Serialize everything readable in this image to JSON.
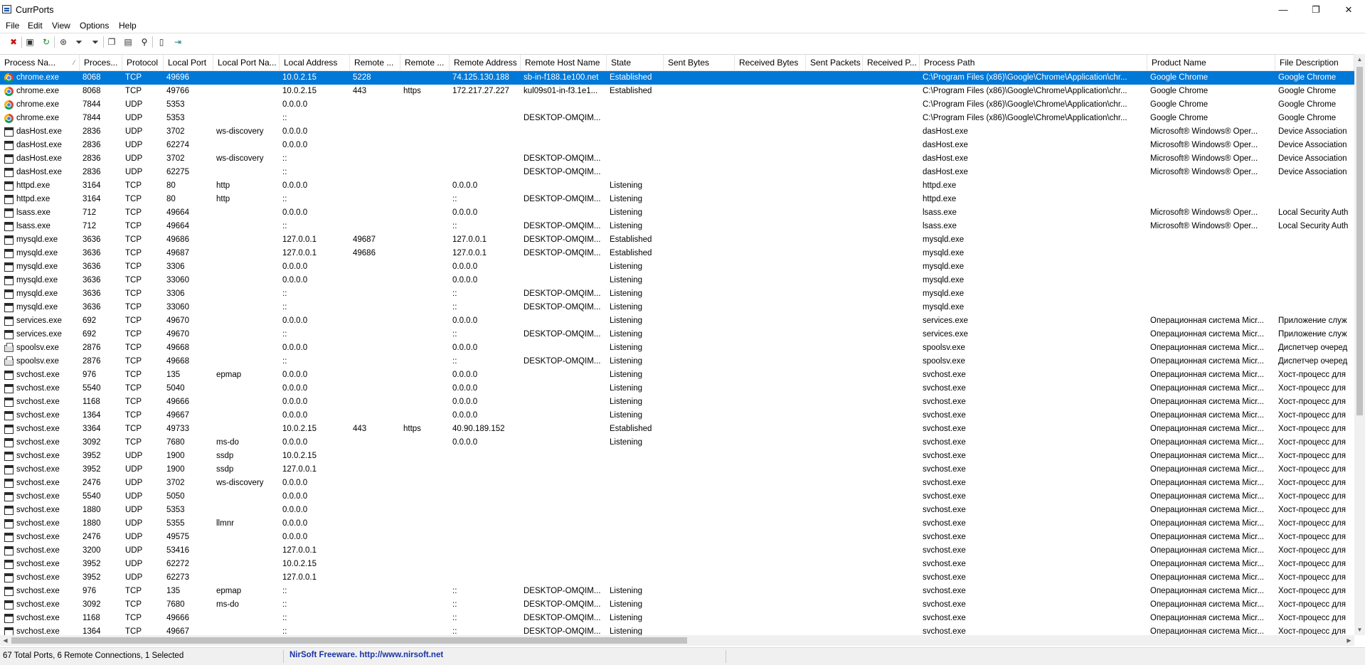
{
  "window": {
    "title": "CurrPorts",
    "minimize": "—",
    "maximize": "❐",
    "close": "✕"
  },
  "menu": [
    "File",
    "Edit",
    "View",
    "Options",
    "Help"
  ],
  "toolbar": [
    {
      "name": "delete-icon",
      "glyph": "✖",
      "color": "#cc1111"
    },
    {
      "name": "save-icon",
      "glyph": "▣",
      "color": "#333333"
    },
    {
      "name": "refresh-icon",
      "glyph": "↻",
      "color": "#188a2a"
    },
    {
      "name": "options-icon",
      "glyph": "⊛",
      "color": "#333333"
    },
    {
      "name": "filter-icon",
      "glyph": "⏷",
      "color": "#333333"
    },
    {
      "name": "advanced-filter-icon",
      "glyph": "⏷",
      "color": "#333333"
    },
    {
      "name": "copy-icon",
      "glyph": "❐",
      "color": "#333333"
    },
    {
      "name": "properties-icon",
      "glyph": "▤",
      "color": "#333333"
    },
    {
      "name": "find-icon",
      "glyph": "⚲",
      "color": "#111111"
    },
    {
      "name": "report-icon",
      "glyph": "▯",
      "color": "#333333"
    },
    {
      "name": "exit-icon",
      "glyph": "⇥",
      "color": "#1a7a80"
    }
  ],
  "columns": [
    "Process Na...",
    "Proces...",
    "Protocol",
    "Local Port",
    "Local Port Na...",
    "Local Address",
    "Remote ...",
    "Remote ...",
    "Remote Address",
    "Remote Host Name",
    "State",
    "Sent Bytes",
    "Received Bytes",
    "Sent Packets",
    "Received P...",
    "Process Path",
    "Product Name",
    "File Description"
  ],
  "rows": [
    {
      "icon": "chrome",
      "selected": true,
      "cells": [
        "chrome.exe",
        "8068",
        "TCP",
        "49696",
        "",
        "10.0.2.15",
        "5228",
        "",
        "74.125.130.188",
        "sb-in-f188.1e100.net",
        "Established",
        "",
        "",
        "",
        "",
        "C:\\Program Files (x86)\\Google\\Chrome\\Application\\chr...",
        "Google Chrome",
        "Google Chrome"
      ]
    },
    {
      "icon": "chrome",
      "cells": [
        "chrome.exe",
        "8068",
        "TCP",
        "49766",
        "",
        "10.0.2.15",
        "443",
        "https",
        "172.217.27.227",
        "kul09s01-in-f3.1e1...",
        "Established",
        "",
        "",
        "",
        "",
        "C:\\Program Files (x86)\\Google\\Chrome\\Application\\chr...",
        "Google Chrome",
        "Google Chrome"
      ]
    },
    {
      "icon": "chrome",
      "cells": [
        "chrome.exe",
        "7844",
        "UDP",
        "5353",
        "",
        "0.0.0.0",
        "",
        "",
        "",
        "",
        "",
        "",
        "",
        "",
        "",
        "C:\\Program Files (x86)\\Google\\Chrome\\Application\\chr...",
        "Google Chrome",
        "Google Chrome"
      ]
    },
    {
      "icon": "chrome",
      "cells": [
        "chrome.exe",
        "7844",
        "UDP",
        "5353",
        "",
        "::",
        "",
        "",
        "",
        "DESKTOP-OMQIM...",
        "",
        "",
        "",
        "",
        "",
        "C:\\Program Files (x86)\\Google\\Chrome\\Application\\chr...",
        "Google Chrome",
        "Google Chrome"
      ]
    },
    {
      "icon": "window",
      "cells": [
        "dasHost.exe",
        "2836",
        "UDP",
        "3702",
        "ws-discovery",
        "0.0.0.0",
        "",
        "",
        "",
        "",
        "",
        "",
        "",
        "",
        "",
        "dasHost.exe",
        "Microsoft® Windows® Oper...",
        "Device Association"
      ]
    },
    {
      "icon": "window",
      "cells": [
        "dasHost.exe",
        "2836",
        "UDP",
        "62274",
        "",
        "0.0.0.0",
        "",
        "",
        "",
        "",
        "",
        "",
        "",
        "",
        "",
        "dasHost.exe",
        "Microsoft® Windows® Oper...",
        "Device Association"
      ]
    },
    {
      "icon": "window",
      "cells": [
        "dasHost.exe",
        "2836",
        "UDP",
        "3702",
        "ws-discovery",
        "::",
        "",
        "",
        "",
        "DESKTOP-OMQIM...",
        "",
        "",
        "",
        "",
        "",
        "dasHost.exe",
        "Microsoft® Windows® Oper...",
        "Device Association"
      ]
    },
    {
      "icon": "window",
      "cells": [
        "dasHost.exe",
        "2836",
        "UDP",
        "62275",
        "",
        "::",
        "",
        "",
        "",
        "DESKTOP-OMQIM...",
        "",
        "",
        "",
        "",
        "",
        "dasHost.exe",
        "Microsoft® Windows® Oper...",
        "Device Association"
      ]
    },
    {
      "icon": "window",
      "cells": [
        "httpd.exe",
        "3164",
        "TCP",
        "80",
        "http",
        "0.0.0.0",
        "",
        "",
        "0.0.0.0",
        "",
        "Listening",
        "",
        "",
        "",
        "",
        "httpd.exe",
        "",
        ""
      ]
    },
    {
      "icon": "window",
      "cells": [
        "httpd.exe",
        "3164",
        "TCP",
        "80",
        "http",
        "::",
        "",
        "",
        "::",
        "DESKTOP-OMQIM...",
        "Listening",
        "",
        "",
        "",
        "",
        "httpd.exe",
        "",
        ""
      ]
    },
    {
      "icon": "window",
      "cells": [
        "lsass.exe",
        "712",
        "TCP",
        "49664",
        "",
        "0.0.0.0",
        "",
        "",
        "0.0.0.0",
        "",
        "Listening",
        "",
        "",
        "",
        "",
        "lsass.exe",
        "Microsoft® Windows® Oper...",
        "Local Security Auth"
      ]
    },
    {
      "icon": "window",
      "cells": [
        "lsass.exe",
        "712",
        "TCP",
        "49664",
        "",
        "::",
        "",
        "",
        "::",
        "DESKTOP-OMQIM...",
        "Listening",
        "",
        "",
        "",
        "",
        "lsass.exe",
        "Microsoft® Windows® Oper...",
        "Local Security Auth"
      ]
    },
    {
      "icon": "window",
      "cells": [
        "mysqld.exe",
        "3636",
        "TCP",
        "49686",
        "",
        "127.0.0.1",
        "49687",
        "",
        "127.0.0.1",
        "DESKTOP-OMQIM...",
        "Established",
        "",
        "",
        "",
        "",
        "mysqld.exe",
        "",
        ""
      ]
    },
    {
      "icon": "window",
      "cells": [
        "mysqld.exe",
        "3636",
        "TCP",
        "49687",
        "",
        "127.0.0.1",
        "49686",
        "",
        "127.0.0.1",
        "DESKTOP-OMQIM...",
        "Established",
        "",
        "",
        "",
        "",
        "mysqld.exe",
        "",
        ""
      ]
    },
    {
      "icon": "window",
      "cells": [
        "mysqld.exe",
        "3636",
        "TCP",
        "3306",
        "",
        "0.0.0.0",
        "",
        "",
        "0.0.0.0",
        "",
        "Listening",
        "",
        "",
        "",
        "",
        "mysqld.exe",
        "",
        ""
      ]
    },
    {
      "icon": "window",
      "cells": [
        "mysqld.exe",
        "3636",
        "TCP",
        "33060",
        "",
        "0.0.0.0",
        "",
        "",
        "0.0.0.0",
        "",
        "Listening",
        "",
        "",
        "",
        "",
        "mysqld.exe",
        "",
        ""
      ]
    },
    {
      "icon": "window",
      "cells": [
        "mysqld.exe",
        "3636",
        "TCP",
        "3306",
        "",
        "::",
        "",
        "",
        "::",
        "DESKTOP-OMQIM...",
        "Listening",
        "",
        "",
        "",
        "",
        "mysqld.exe",
        "",
        ""
      ]
    },
    {
      "icon": "window",
      "cells": [
        "mysqld.exe",
        "3636",
        "TCP",
        "33060",
        "",
        "::",
        "",
        "",
        "::",
        "DESKTOP-OMQIM...",
        "Listening",
        "",
        "",
        "",
        "",
        "mysqld.exe",
        "",
        ""
      ]
    },
    {
      "icon": "window",
      "cells": [
        "services.exe",
        "692",
        "TCP",
        "49670",
        "",
        "0.0.0.0",
        "",
        "",
        "0.0.0.0",
        "",
        "Listening",
        "",
        "",
        "",
        "",
        "services.exe",
        "Операционная система Micr...",
        "Приложение служ"
      ]
    },
    {
      "icon": "window",
      "cells": [
        "services.exe",
        "692",
        "TCP",
        "49670",
        "",
        "::",
        "",
        "",
        "::",
        "DESKTOP-OMQIM...",
        "Listening",
        "",
        "",
        "",
        "",
        "services.exe",
        "Операционная система Micr...",
        "Приложение служ"
      ]
    },
    {
      "icon": "printer",
      "cells": [
        "spoolsv.exe",
        "2876",
        "TCP",
        "49668",
        "",
        "0.0.0.0",
        "",
        "",
        "0.0.0.0",
        "",
        "Listening",
        "",
        "",
        "",
        "",
        "spoolsv.exe",
        "Операционная система Micr...",
        "Диспетчер очеред"
      ]
    },
    {
      "icon": "printer",
      "cells": [
        "spoolsv.exe",
        "2876",
        "TCP",
        "49668",
        "",
        "::",
        "",
        "",
        "::",
        "DESKTOP-OMQIM...",
        "Listening",
        "",
        "",
        "",
        "",
        "spoolsv.exe",
        "Операционная система Micr...",
        "Диспетчер очеред"
      ]
    },
    {
      "icon": "window",
      "cells": [
        "svchost.exe",
        "976",
        "TCP",
        "135",
        "epmap",
        "0.0.0.0",
        "",
        "",
        "0.0.0.0",
        "",
        "Listening",
        "",
        "",
        "",
        "",
        "svchost.exe",
        "Операционная система Micr...",
        "Хост-процесс для"
      ]
    },
    {
      "icon": "window",
      "cells": [
        "svchost.exe",
        "5540",
        "TCP",
        "5040",
        "",
        "0.0.0.0",
        "",
        "",
        "0.0.0.0",
        "",
        "Listening",
        "",
        "",
        "",
        "",
        "svchost.exe",
        "Операционная система Micr...",
        "Хост-процесс для"
      ]
    },
    {
      "icon": "window",
      "cells": [
        "svchost.exe",
        "1168",
        "TCP",
        "49666",
        "",
        "0.0.0.0",
        "",
        "",
        "0.0.0.0",
        "",
        "Listening",
        "",
        "",
        "",
        "",
        "svchost.exe",
        "Операционная система Micr...",
        "Хост-процесс для"
      ]
    },
    {
      "icon": "window",
      "cells": [
        "svchost.exe",
        "1364",
        "TCP",
        "49667",
        "",
        "0.0.0.0",
        "",
        "",
        "0.0.0.0",
        "",
        "Listening",
        "",
        "",
        "",
        "",
        "svchost.exe",
        "Операционная система Micr...",
        "Хост-процесс для"
      ]
    },
    {
      "icon": "window",
      "cells": [
        "svchost.exe",
        "3364",
        "TCP",
        "49733",
        "",
        "10.0.2.15",
        "443",
        "https",
        "40.90.189.152",
        "",
        "Established",
        "",
        "",
        "",
        "",
        "svchost.exe",
        "Операционная система Micr...",
        "Хост-процесс для"
      ]
    },
    {
      "icon": "window",
      "cells": [
        "svchost.exe",
        "3092",
        "TCP",
        "7680",
        "ms-do",
        "0.0.0.0",
        "",
        "",
        "0.0.0.0",
        "",
        "Listening",
        "",
        "",
        "",
        "",
        "svchost.exe",
        "Операционная система Micr...",
        "Хост-процесс для"
      ]
    },
    {
      "icon": "window",
      "cells": [
        "svchost.exe",
        "3952",
        "UDP",
        "1900",
        "ssdp",
        "10.0.2.15",
        "",
        "",
        "",
        "",
        "",
        "",
        "",
        "",
        "",
        "svchost.exe",
        "Операционная система Micr...",
        "Хост-процесс для"
      ]
    },
    {
      "icon": "window",
      "cells": [
        "svchost.exe",
        "3952",
        "UDP",
        "1900",
        "ssdp",
        "127.0.0.1",
        "",
        "",
        "",
        "",
        "",
        "",
        "",
        "",
        "",
        "svchost.exe",
        "Операционная система Micr...",
        "Хост-процесс для"
      ]
    },
    {
      "icon": "window",
      "cells": [
        "svchost.exe",
        "2476",
        "UDP",
        "3702",
        "ws-discovery",
        "0.0.0.0",
        "",
        "",
        "",
        "",
        "",
        "",
        "",
        "",
        "",
        "svchost.exe",
        "Операционная система Micr...",
        "Хост-процесс для"
      ]
    },
    {
      "icon": "window",
      "cells": [
        "svchost.exe",
        "5540",
        "UDP",
        "5050",
        "",
        "0.0.0.0",
        "",
        "",
        "",
        "",
        "",
        "",
        "",
        "",
        "",
        "svchost.exe",
        "Операционная система Micr...",
        "Хост-процесс для"
      ]
    },
    {
      "icon": "window",
      "cells": [
        "svchost.exe",
        "1880",
        "UDP",
        "5353",
        "",
        "0.0.0.0",
        "",
        "",
        "",
        "",
        "",
        "",
        "",
        "",
        "",
        "svchost.exe",
        "Операционная система Micr...",
        "Хост-процесс для"
      ]
    },
    {
      "icon": "window",
      "cells": [
        "svchost.exe",
        "1880",
        "UDP",
        "5355",
        "llmnr",
        "0.0.0.0",
        "",
        "",
        "",
        "",
        "",
        "",
        "",
        "",
        "",
        "svchost.exe",
        "Операционная система Micr...",
        "Хост-процесс для"
      ]
    },
    {
      "icon": "window",
      "cells": [
        "svchost.exe",
        "2476",
        "UDP",
        "49575",
        "",
        "0.0.0.0",
        "",
        "",
        "",
        "",
        "",
        "",
        "",
        "",
        "",
        "svchost.exe",
        "Операционная система Micr...",
        "Хост-процесс для"
      ]
    },
    {
      "icon": "window",
      "cells": [
        "svchost.exe",
        "3200",
        "UDP",
        "53416",
        "",
        "127.0.0.1",
        "",
        "",
        "",
        "",
        "",
        "",
        "",
        "",
        "",
        "svchost.exe",
        "Операционная система Micr...",
        "Хост-процесс для"
      ]
    },
    {
      "icon": "window",
      "cells": [
        "svchost.exe",
        "3952",
        "UDP",
        "62272",
        "",
        "10.0.2.15",
        "",
        "",
        "",
        "",
        "",
        "",
        "",
        "",
        "",
        "svchost.exe",
        "Операционная система Micr...",
        "Хост-процесс для"
      ]
    },
    {
      "icon": "window",
      "cells": [
        "svchost.exe",
        "3952",
        "UDP",
        "62273",
        "",
        "127.0.0.1",
        "",
        "",
        "",
        "",
        "",
        "",
        "",
        "",
        "",
        "svchost.exe",
        "Операционная система Micr...",
        "Хост-процесс для"
      ]
    },
    {
      "icon": "window",
      "cells": [
        "svchost.exe",
        "976",
        "TCP",
        "135",
        "epmap",
        "::",
        "",
        "",
        "::",
        "DESKTOP-OMQIM...",
        "Listening",
        "",
        "",
        "",
        "",
        "svchost.exe",
        "Операционная система Micr...",
        "Хост-процесс для"
      ]
    },
    {
      "icon": "window",
      "cells": [
        "svchost.exe",
        "3092",
        "TCP",
        "7680",
        "ms-do",
        "::",
        "",
        "",
        "::",
        "DESKTOP-OMQIM...",
        "Listening",
        "",
        "",
        "",
        "",
        "svchost.exe",
        "Операционная система Micr...",
        "Хост-процесс для"
      ]
    },
    {
      "icon": "window",
      "cells": [
        "svchost.exe",
        "1168",
        "TCP",
        "49666",
        "",
        "::",
        "",
        "",
        "::",
        "DESKTOP-OMQIM...",
        "Listening",
        "",
        "",
        "",
        "",
        "svchost.exe",
        "Операционная система Micr...",
        "Хост-процесс для"
      ]
    },
    {
      "icon": "window",
      "cells": [
        "svchost.exe",
        "1364",
        "TCP",
        "49667",
        "",
        "::",
        "",
        "",
        "::",
        "DESKTOP-OMQIM...",
        "Listening",
        "",
        "",
        "",
        "",
        "svchost.exe",
        "Операционная система Micr...",
        "Хост-процесс для"
      ]
    }
  ],
  "status": {
    "summary": "67 Total Ports, 6 Remote Connections, 1 Selected",
    "link": "NirSoft Freeware.  http://www.nirsoft.net"
  }
}
